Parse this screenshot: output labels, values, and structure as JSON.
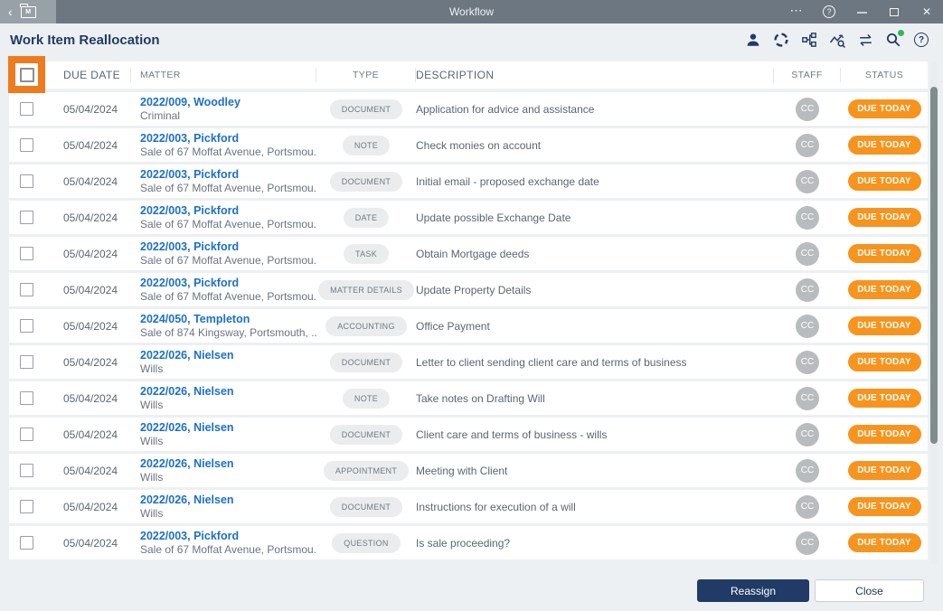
{
  "titlebar": {
    "title": "Workflow",
    "folder_badge": "M",
    "icons": {
      "back": "‹",
      "ellipsis": "⋯",
      "help": "?",
      "close": "✕"
    }
  },
  "header": {
    "title": "Work Item Reallocation",
    "help_glyph": "?",
    "toolbar_icons": [
      "user-icon",
      "sync-icon",
      "workflow-map-icon",
      "activity-search-icon",
      "swap-arrows-icon",
      "search-icon",
      "help-icon"
    ]
  },
  "table": {
    "columns": {
      "due_date": "DUE DATE",
      "matter": "MATTER",
      "type": "TYPE",
      "description": "DESCRIPTION",
      "staff": "STAFF",
      "status": "STATUS"
    },
    "rows": [
      {
        "due_date": "05/04/2024",
        "matter_ref": "2022/009, Woodley",
        "matter_desc": "Criminal",
        "type": "DOCUMENT",
        "description": "Application for advice and assistance",
        "staff": "CC",
        "status": "DUE TODAY"
      },
      {
        "due_date": "05/04/2024",
        "matter_ref": "2022/003, Pickford",
        "matter_desc": "Sale of 67 Moffat Avenue, Portsmou...",
        "type": "NOTE",
        "description": "Check monies on account",
        "staff": "CC",
        "status": "DUE TODAY"
      },
      {
        "due_date": "05/04/2024",
        "matter_ref": "2022/003, Pickford",
        "matter_desc": "Sale of 67 Moffat Avenue, Portsmou...",
        "type": "DOCUMENT",
        "description": "Initial email - proposed exchange date",
        "staff": "CC",
        "status": "DUE TODAY"
      },
      {
        "due_date": "05/04/2024",
        "matter_ref": "2022/003, Pickford",
        "matter_desc": "Sale of 67 Moffat Avenue, Portsmou...",
        "type": "DATE",
        "description": "Update possible Exchange Date",
        "staff": "CC",
        "status": "DUE TODAY"
      },
      {
        "due_date": "05/04/2024",
        "matter_ref": "2022/003, Pickford",
        "matter_desc": "Sale of 67 Moffat Avenue, Portsmou...",
        "type": "TASK",
        "description": "Obtain Mortgage deeds",
        "staff": "CC",
        "status": "DUE TODAY"
      },
      {
        "due_date": "05/04/2024",
        "matter_ref": "2022/003, Pickford",
        "matter_desc": "Sale of 67 Moffat Avenue, Portsmou...",
        "type": "MATTER DETAILS",
        "description": "Update Property Details",
        "staff": "CC",
        "status": "DUE TODAY"
      },
      {
        "due_date": "05/04/2024",
        "matter_ref": "2024/050, Templeton",
        "matter_desc": "Sale of 874 Kingsway, Portsmouth, ...",
        "type": "ACCOUNTING",
        "description": "Office Payment",
        "staff": "CC",
        "status": "DUE TODAY"
      },
      {
        "due_date": "05/04/2024",
        "matter_ref": "2022/026, Nielsen",
        "matter_desc": "Wills",
        "type": "DOCUMENT",
        "description": "Letter to client sending client care and terms of business",
        "staff": "CC",
        "status": "DUE TODAY"
      },
      {
        "due_date": "05/04/2024",
        "matter_ref": "2022/026, Nielsen",
        "matter_desc": "Wills",
        "type": "NOTE",
        "description": "Take notes on Drafting Will",
        "staff": "CC",
        "status": "DUE TODAY"
      },
      {
        "due_date": "05/04/2024",
        "matter_ref": "2022/026, Nielsen",
        "matter_desc": "Wills",
        "type": "DOCUMENT",
        "description": "Client care and terms of business - wills",
        "staff": "CC",
        "status": "DUE TODAY"
      },
      {
        "due_date": "05/04/2024",
        "matter_ref": "2022/026, Nielsen",
        "matter_desc": "Wills",
        "type": "APPOINTMENT",
        "description": "Meeting with Client",
        "staff": "CC",
        "status": "DUE TODAY"
      },
      {
        "due_date": "05/04/2024",
        "matter_ref": "2022/026, Nielsen",
        "matter_desc": "Wills",
        "type": "DOCUMENT",
        "description": "Instructions for execution of a will",
        "staff": "CC",
        "status": "DUE TODAY"
      },
      {
        "due_date": "05/04/2024",
        "matter_ref": "2022/003, Pickford",
        "matter_desc": "Sale of 67 Moffat Avenue, Portsmou...",
        "type": "QUESTION",
        "description": "Is sale proceeding?",
        "staff": "CC",
        "status": "DUE TODAY"
      }
    ]
  },
  "footer": {
    "reassign_label": "Reassign",
    "close_label": "Close"
  },
  "colors": {
    "accent": "#f7941e",
    "highlight": "#ee7b1e",
    "navy": "#203b66",
    "link": "#1d70c8",
    "green": "#2eb85c",
    "titlebar": "#6d7781",
    "titlebar-left": "#99a1a8",
    "bg": "#edf0f3",
    "pill": "#ebeced",
    "avatar": "#b9bcbf"
  }
}
